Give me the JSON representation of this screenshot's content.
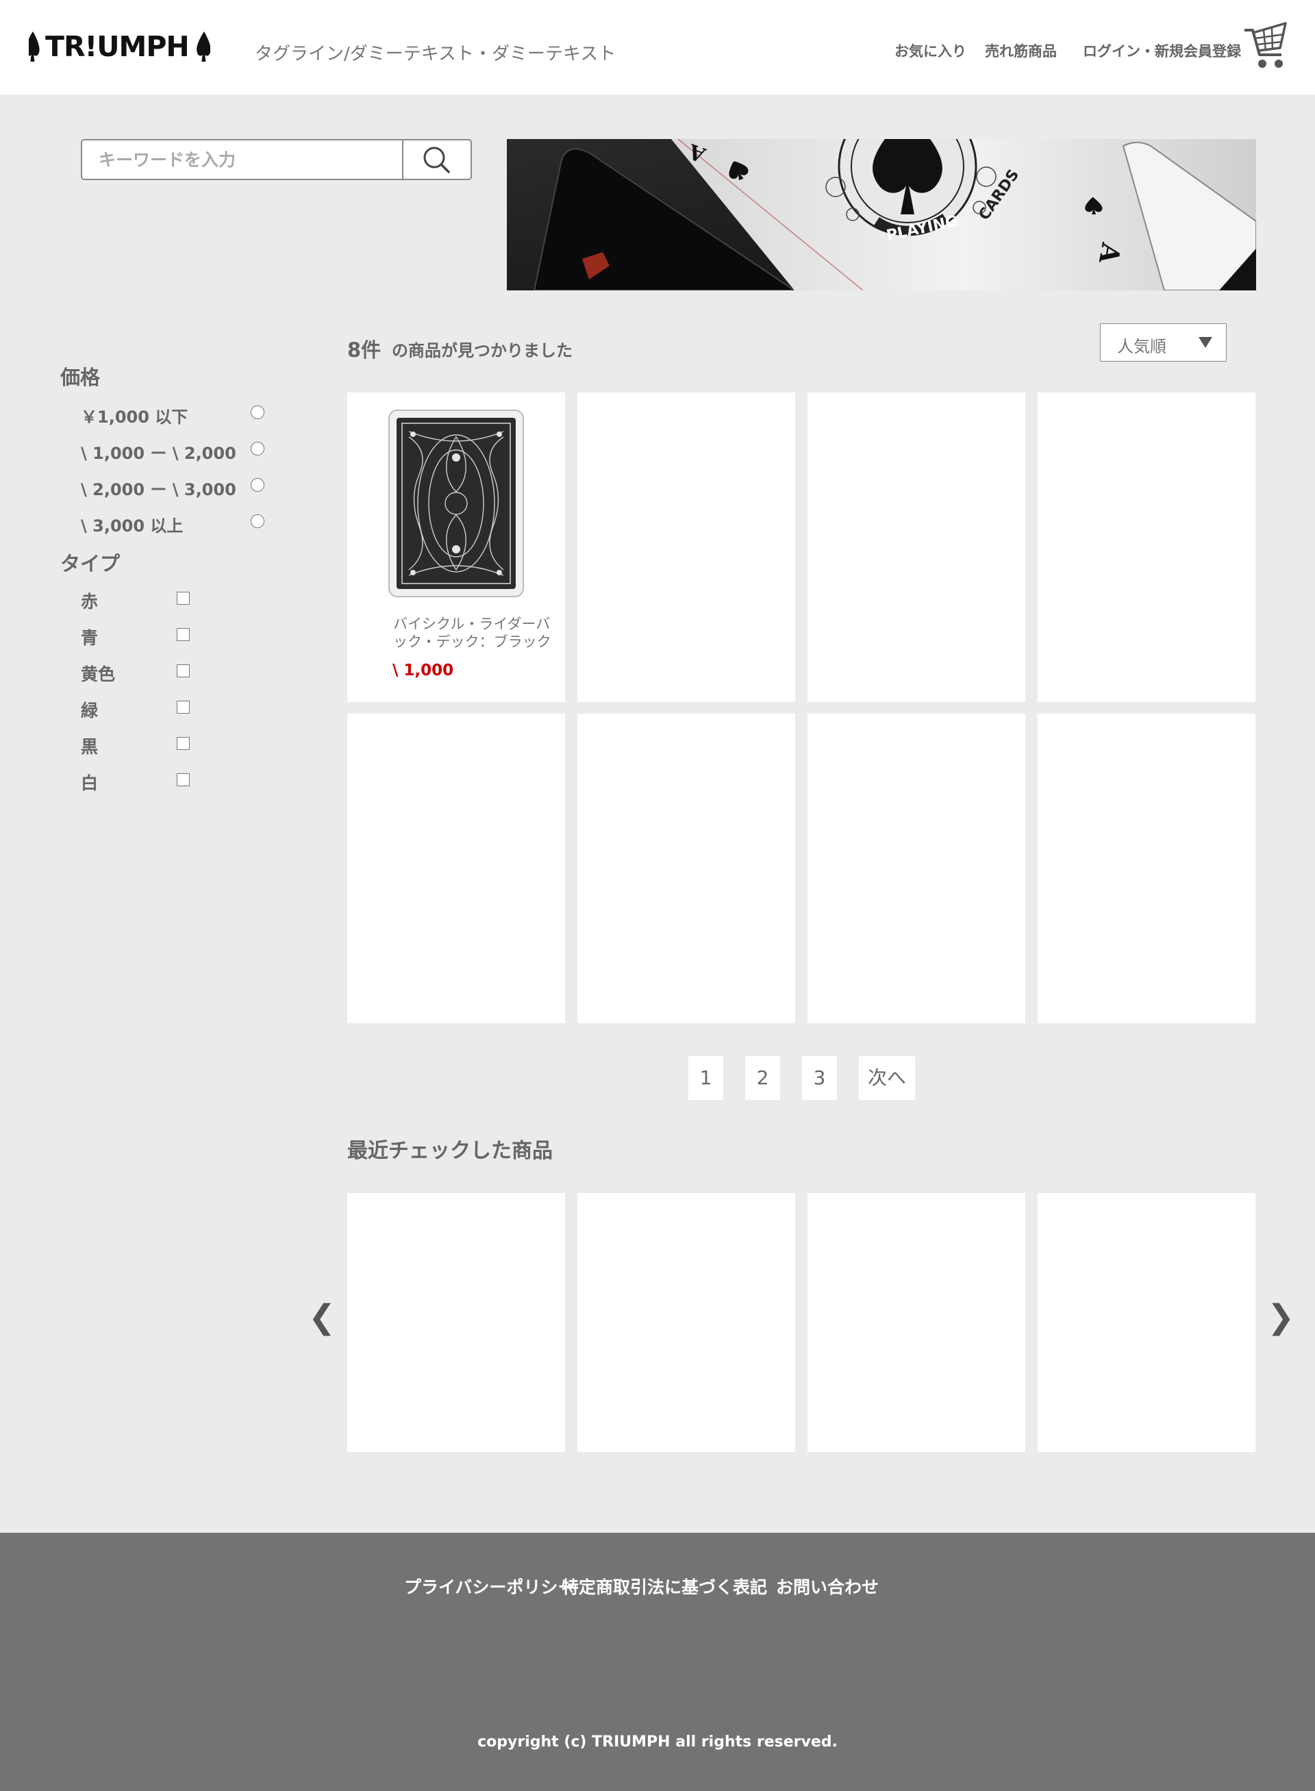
{
  "header": {
    "logo": "TR!UMPH",
    "tagline": "タグライン/ダミーテキスト・ダミーテキスト",
    "nav": {
      "favorites": "お気に入り",
      "bestsellers": "売れ筋商品",
      "login": "ログイン・新規会員登録"
    }
  },
  "search": {
    "placeholder": "キーワードを入力"
  },
  "filters": {
    "price_title": "価格",
    "price_options": [
      "￥1,000 以下",
      "\\ 1,000 ー \\ 2,000",
      "\\ 2,000 ー \\ 3,000",
      "\\ 3,000 以上"
    ],
    "type_title": "タイプ",
    "type_options": [
      "赤",
      "青",
      "黄色",
      "緑",
      "黒",
      "白"
    ]
  },
  "results": {
    "count": "8件",
    "count_text": "の商品が見つかりました",
    "sort": "人気順",
    "products": [
      {
        "name": "バイシクル・ライダーバック・デック：ブラック",
        "price": "\\ 1,000"
      }
    ]
  },
  "pagination": [
    "1",
    "2",
    "3",
    "次へ"
  ],
  "recent": {
    "title": "最近チェックした商品"
  },
  "footer": {
    "links": [
      "プライバシーポリシー",
      "特定商取引法に基づく表記",
      "お問い合わせ"
    ],
    "copyright": "copyright (c) TRIUMPH all rights reserved."
  },
  "icons": {
    "search": "search-icon",
    "cart": "cart-icon",
    "prev": "chevron-left-icon",
    "next": "chevron-right-icon"
  },
  "colors": {
    "price": "#cc0000",
    "footer": "#737373",
    "background": "#ebebeb"
  }
}
